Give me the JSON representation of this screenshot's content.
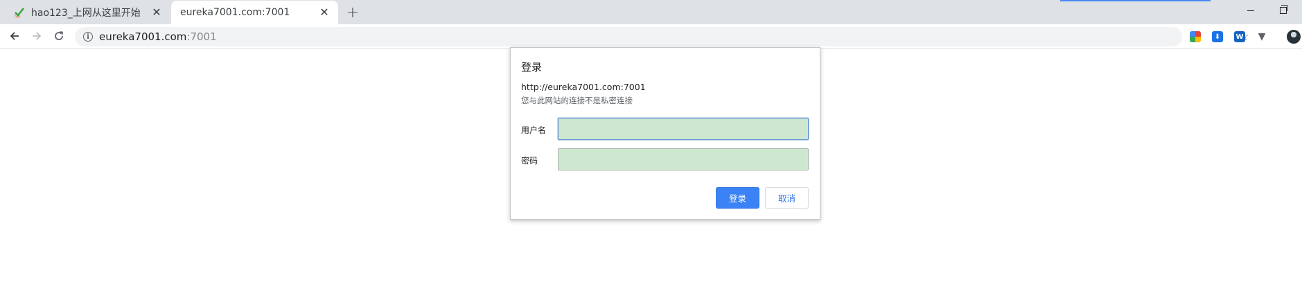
{
  "tabs": [
    {
      "title": "hao123_上网从这里开始",
      "favicon": "hao123-favicon",
      "active": false
    },
    {
      "title": "eureka7001.com:7001",
      "favicon": "none",
      "active": true
    }
  ],
  "toolbar": {
    "url_host": "eureka7001.com",
    "url_port": ":7001",
    "extensions": [
      "colorful-extension-icon",
      "save-extension-icon",
      "w-extension-icon",
      "v-extension-icon"
    ]
  },
  "auth_dialog": {
    "title": "登录",
    "origin": "http://eureka7001.com:7001",
    "warning": "您与此网站的连接不是私密连接",
    "username_label": "用户名",
    "password_label": "密码",
    "username_value": "",
    "password_value": "",
    "login_button": "登录",
    "cancel_button": "取消"
  },
  "colors": {
    "tabstrip": "#dee1e6",
    "field_fill": "#cde8cf",
    "primary_button": "#3b82f6",
    "link_blue": "#3b78e7"
  }
}
